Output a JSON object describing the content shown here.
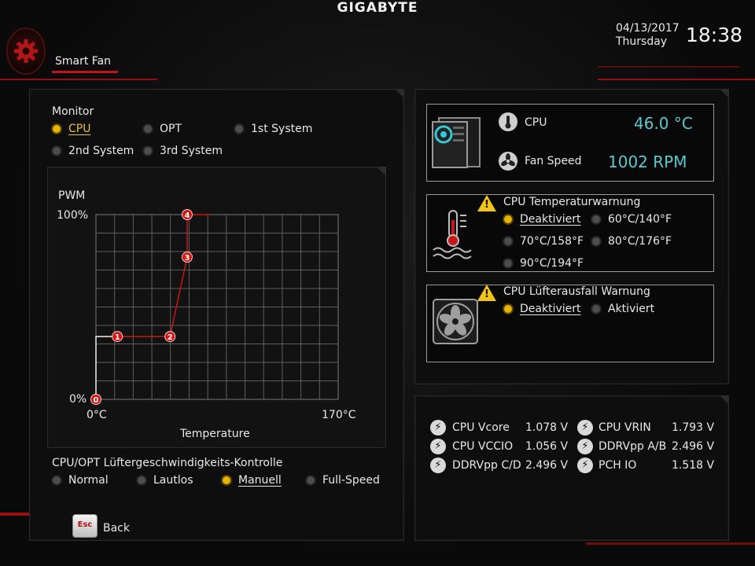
{
  "header": {
    "brand": "GIGABYTE",
    "title": "Smart Fan",
    "date": "04/13/2017",
    "weekday": "Thursday",
    "time": "18:38"
  },
  "monitor": {
    "label": "Monitor",
    "options": [
      "CPU",
      "OPT",
      "1st System",
      "2nd System",
      "3rd System"
    ],
    "selected": "CPU"
  },
  "chart_data": {
    "type": "line",
    "ylabel": "PWM",
    "xlabel": "Temperature",
    "x_ticks": [
      "0°C",
      "170°C"
    ],
    "y_ticks": [
      "0%",
      "100%"
    ],
    "xlim": [
      0,
      170
    ],
    "ylim": [
      0,
      100
    ],
    "grid": true,
    "points": [
      {
        "label": "0",
        "x": 0,
        "y": 0
      },
      {
        "label": "1",
        "x": 15,
        "y": 34
      },
      {
        "label": "2",
        "x": 52,
        "y": 34
      },
      {
        "label": "3",
        "x": 64,
        "y": 77
      },
      {
        "label": "4",
        "x": 64,
        "y": 100
      }
    ],
    "line_color": "#c81818"
  },
  "control": {
    "label": "CPU/OPT Lüftergeschwindigkeits-Kontrolle",
    "options": [
      "Normal",
      "Lautlos",
      "Manuell",
      "Full-Speed"
    ],
    "selected": "Manuell"
  },
  "status": {
    "cpu_label": "CPU",
    "cpu_temp": "46.0 °C",
    "fan_label": "Fan Speed",
    "fan_speed": "1002 RPM"
  },
  "temp_warning": {
    "title": "CPU Temperaturwarnung",
    "options": [
      "Deaktiviert",
      "60°C/140°F",
      "70°C/158°F",
      "80°C/176°F",
      "90°C/194°F"
    ],
    "selected": "Deaktiviert"
  },
  "fan_fail_warning": {
    "title": "CPU Lüfterausfall Warnung",
    "options": [
      "Deaktiviert",
      "Aktiviert"
    ],
    "selected": "Deaktiviert"
  },
  "voltages": [
    {
      "name": "CPU Vcore",
      "value": "1.078 V"
    },
    {
      "name": "CPU VRIN",
      "value": "1.793 V"
    },
    {
      "name": "CPU VCCIO",
      "value": "1.056 V"
    },
    {
      "name": "DDRVpp A/B",
      "value": "2.496 V"
    },
    {
      "name": "DDRVpp C/D",
      "value": "2.496 V"
    },
    {
      "name": "PCH IO",
      "value": "1.518 V"
    }
  ],
  "footer": {
    "esc_key": "Esc",
    "back_label": "Back"
  },
  "colors": {
    "accent_red": "#c3121a",
    "selected_yellow": "#e8b400",
    "value_cyan": "#5cc9cf"
  }
}
